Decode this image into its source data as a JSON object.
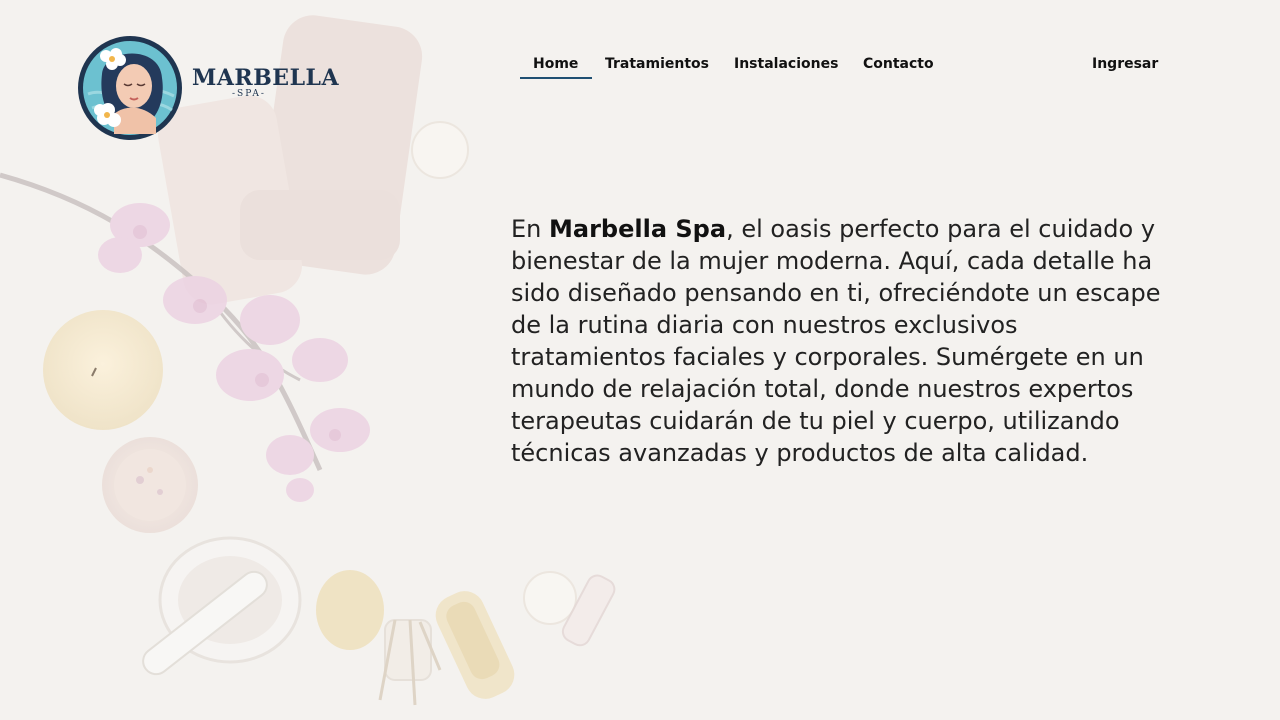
{
  "logo": {
    "wordmark": "MARBELLA",
    "subtitle": "-SPA-"
  },
  "nav": {
    "items": [
      {
        "label": "Home",
        "active": true
      },
      {
        "label": "Tratamientos",
        "active": false
      },
      {
        "label": "Instalaciones",
        "active": false
      },
      {
        "label": "Contacto",
        "active": false
      }
    ],
    "login_label": "Ingresar",
    "active_underline_color": "#1f4f72"
  },
  "intro": {
    "prefix": "En ",
    "brand": "Marbella Spa",
    "body": ", el oasis perfecto para el cuidado y bienestar de la mujer moderna. Aquí, cada detalle ha sido diseñado pensando en ti, ofreciéndote un escape de la rutina diaria con nuestros exclusivos tratamientos faciales y corporales. Sumérgete en un mundo de relajación total, donde nuestros expertos terapeutas cuidarán de tu piel y cuerpo, utilizando técnicas avanzadas y productos de alta calidad."
  },
  "colors": {
    "background": "#f4f2ef",
    "text": "#222222",
    "brand_navy": "#1f3550",
    "emblem_teal": "#5fb8c8"
  }
}
